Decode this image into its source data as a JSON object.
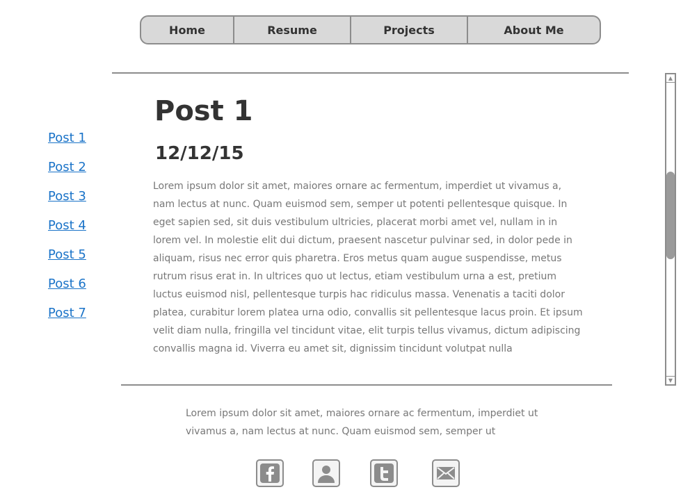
{
  "nav": {
    "items": [
      {
        "label": "Home"
      },
      {
        "label": "Resume"
      },
      {
        "label": "Projects"
      },
      {
        "label": "About Me"
      }
    ]
  },
  "sidebar": {
    "posts": [
      {
        "label": "Post  1"
      },
      {
        "label": "Post 2"
      },
      {
        "label": "Post 3"
      },
      {
        "label": "Post  4"
      },
      {
        "label": "Post 5"
      },
      {
        "label": "Post 6"
      },
      {
        "label": "Post  7"
      }
    ]
  },
  "post": {
    "title": "Post 1",
    "date": "12/12/15",
    "body": "Lorem ipsum dolor sit amet, maiores ornare ac fermentum, imperdiet ut vivamus a, nam lectus at nunc. Quam euismod sem, semper ut potenti pellentesque quisque. In eget sapien sed, sit duis vestibulum ultricies, placerat morbi amet vel, nullam in in lorem vel. In molestie elit dui dictum, praesent nascetur pulvinar sed, in dolor pede in aliquam, risus nec error quis pharetra. Eros metus quam augue suspendisse, metus rutrum risus erat in.  In ultrices quo ut lectus, etiam vestibulum urna a est, pretium luctus euismod nisl, pellentesque turpis hac ridiculus massa. Venenatis a taciti dolor platea, curabitur lorem platea urna odio, convallis sit pellentesque lacus proin. Et ipsum velit diam nulla, fringilla vel tincidunt vitae, elit turpis tellus vivamus, dictum adipiscing convallis magna id. Viverra eu amet sit, dignissim tincidunt volutpat nulla"
  },
  "footer": {
    "text": "Lorem ipsum dolor sit amet, maiores ornare ac fermentum, imperdiet ut vivamus a, nam lectus at nunc. Quam euismod sem, semper ut",
    "social": [
      {
        "icon": "facebook-icon"
      },
      {
        "icon": "user-icon"
      },
      {
        "icon": "twitter-icon"
      },
      {
        "icon": "mail-icon"
      }
    ]
  },
  "colors": {
    "link": "#1a73c8",
    "nav_bg": "#d9d9d9",
    "border": "#8c8c8c",
    "body_text": "#777777",
    "heading_text": "#333333"
  }
}
